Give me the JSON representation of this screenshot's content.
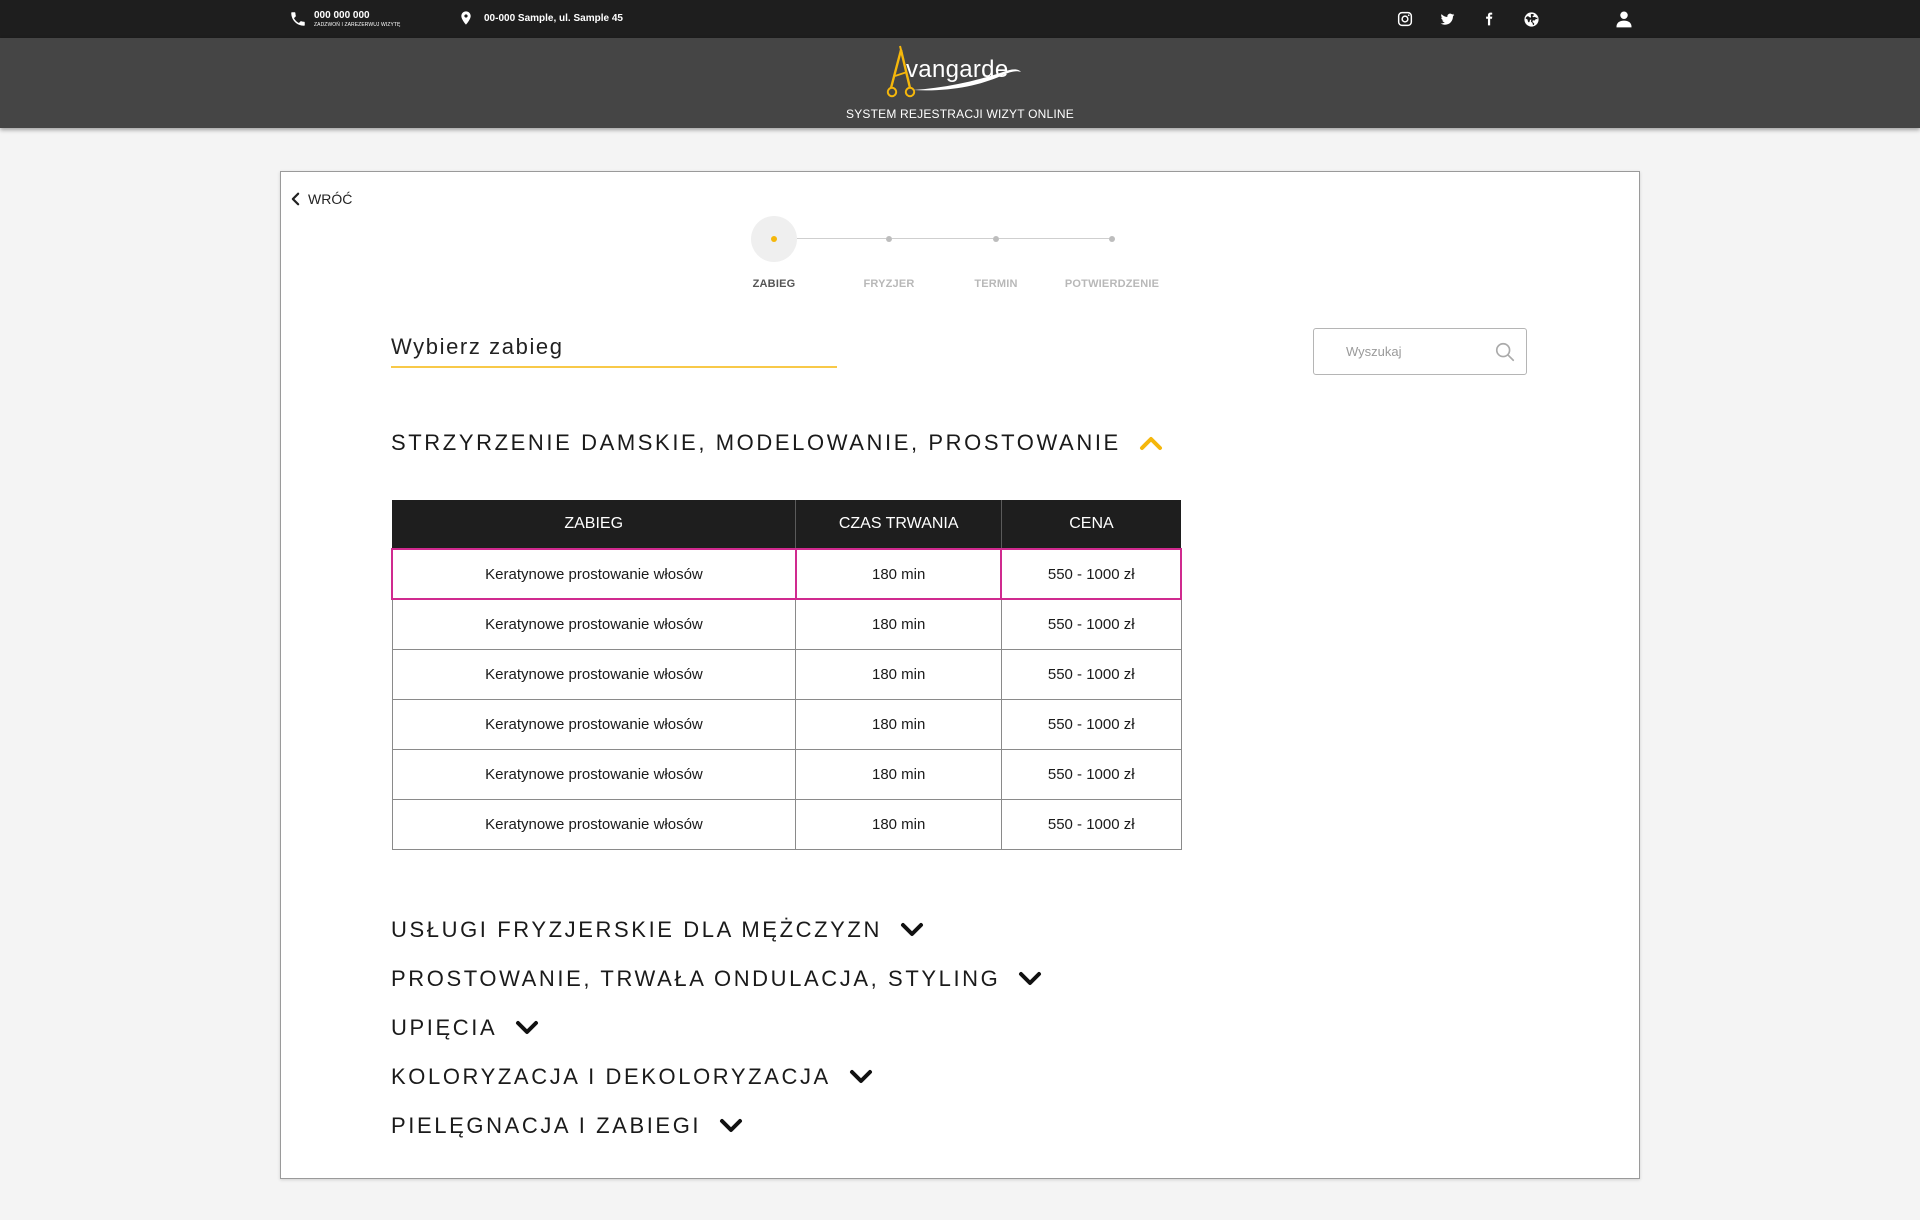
{
  "topbar": {
    "phone": "000 000 000",
    "phone_sub": "ZADZWOŃ I ZAREZERWUJ WIZYTĘ",
    "address": "00-000 Sample, ul. Sample 45"
  },
  "header": {
    "logo_text": "vangarde",
    "subtitle": "SYSTEM REJESTRACJI WIZYT ONLINE"
  },
  "back_label": "WRÓĆ",
  "steps": [
    {
      "label": "ZABIEG",
      "active": true
    },
    {
      "label": "FRYZJER",
      "active": false
    },
    {
      "label": "TERMIN",
      "active": false
    },
    {
      "label": "POTWIERDZENIE",
      "active": false
    }
  ],
  "main": {
    "title": "Wybierz zabieg",
    "search_placeholder": "Wyszukaj"
  },
  "categories": [
    {
      "name": "STRZYRZENIE DAMSKIE, MODELOWANIE, PROSTOWANIE",
      "expanded": true
    },
    {
      "name": "USŁUGI FRYZJERSKIE DLA MĘŻCZYZN",
      "expanded": false
    },
    {
      "name": "PROSTOWANIE, TRWAŁA ONDULACJA, STYLING",
      "expanded": false
    },
    {
      "name": "UPIĘCIA",
      "expanded": false
    },
    {
      "name": "KOLORYZACJA I DEKOLORYZACJA",
      "expanded": false
    },
    {
      "name": "PIELĘGNACJA I ZABIEGI",
      "expanded": false
    }
  ],
  "table": {
    "headers": [
      "ZABIEG",
      "CZAS TRWANIA",
      "CENA"
    ],
    "rows": [
      [
        "Keratynowe prostowanie włosów",
        "180 min",
        "550 - 1000 zł"
      ],
      [
        "Keratynowe prostowanie włosów",
        "180 min",
        "550 - 1000 zł"
      ],
      [
        "Keratynowe prostowanie włosów",
        "180 min",
        "550 - 1000 zł"
      ],
      [
        "Keratynowe prostowanie włosów",
        "180 min",
        "550 - 1000 zł"
      ],
      [
        "Keratynowe prostowanie włosów",
        "180 min",
        "550 - 1000 zł"
      ],
      [
        "Keratynowe prostowanie włosów",
        "180 min",
        "550 - 1000 zł"
      ]
    ],
    "selected_row": 0
  },
  "icons": [
    "phone-icon",
    "location-pin-icon",
    "instagram-icon",
    "twitter-icon",
    "facebook-icon",
    "globe-icon",
    "user-icon",
    "chevron-left-icon",
    "search-icon",
    "chevron-up-icon",
    "chevron-down-icon"
  ],
  "colors": {
    "accent": "#f5b70b",
    "selection": "#d02a8f",
    "topbar": "#1e1e1e",
    "header": "#454545"
  }
}
